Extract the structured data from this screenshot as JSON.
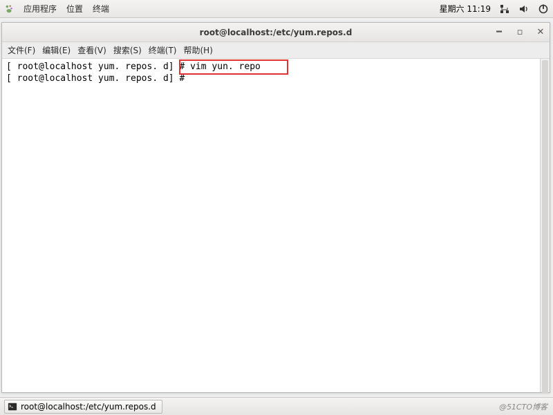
{
  "top_panel": {
    "menus": {
      "apps": "应用程序",
      "places": "位置",
      "terminal": "终端"
    },
    "clock": "星期六 11:19"
  },
  "window": {
    "title": "root@localhost:/etc/yum.repos.d",
    "menubar": {
      "file": "文件(F)",
      "edit": "编辑(E)",
      "view": "查看(V)",
      "search": "搜索(S)",
      "terminal": "终端(T)",
      "help": "帮助(H)"
    },
    "terminal_lines": {
      "l1_prompt": "[ root@localhost yum. repos. d] ",
      "l1_cmd": "# vim yun. repo",
      "l2_prompt": "[ root@localhost yum. repos. d] ",
      "l2_cmd": "# "
    }
  },
  "taskbar": {
    "item_label": "root@localhost:/etc/yum.repos.d"
  },
  "watermark": "@51CTO博客"
}
